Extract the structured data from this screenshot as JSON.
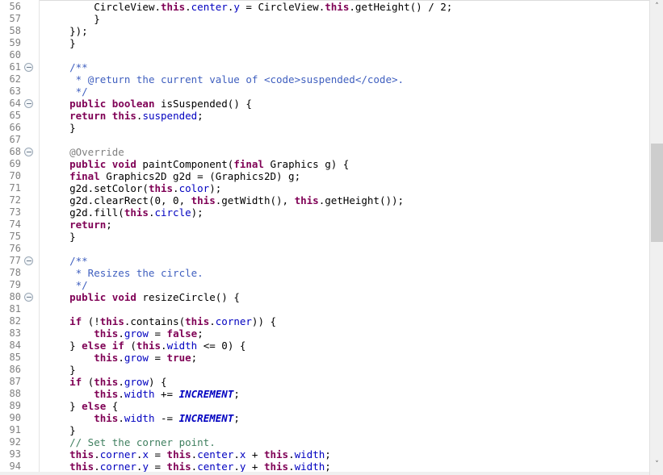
{
  "editor": {
    "first_line": 56,
    "last_line": 94,
    "line_height": 15,
    "colors": {
      "background": "#ffffff",
      "keyword": "#7f0055",
      "field": "#0000c0",
      "static_field": "#0000c0",
      "line_comment": "#3f7f5f",
      "javadoc": "#3f5fbf",
      "annotation": "#808080",
      "plain": "#000000",
      "line_number": "#808080",
      "gutter_separator": "#e4e4e4",
      "scrollbar_track": "#f0f0f0",
      "scrollbar_thumb": "#cdcdcd"
    }
  },
  "scrollbar": {
    "up_arrow": "˄",
    "down_arrow": "˅"
  },
  "lines": [
    {
      "n": 56,
      "fold": false,
      "tokens": [
        {
          "t": "        ",
          "c": "pln"
        },
        {
          "t": "CircleView",
          "c": "pln"
        },
        {
          "t": ".",
          "c": "pln"
        },
        {
          "t": "this",
          "c": "kw"
        },
        {
          "t": ".",
          "c": "pln"
        },
        {
          "t": "center",
          "c": "fld"
        },
        {
          "t": ".",
          "c": "pln"
        },
        {
          "t": "y",
          "c": "fld"
        },
        {
          "t": " = ",
          "c": "pln"
        },
        {
          "t": "CircleView",
          "c": "pln"
        },
        {
          "t": ".",
          "c": "pln"
        },
        {
          "t": "this",
          "c": "kw"
        },
        {
          "t": ".",
          "c": "pln"
        },
        {
          "t": "getHeight() / 2;",
          "c": "pln"
        }
      ]
    },
    {
      "n": 57,
      "fold": false,
      "tokens": [
        {
          "t": "        }",
          "c": "pln"
        }
      ]
    },
    {
      "n": 58,
      "fold": false,
      "tokens": [
        {
          "t": "    });",
          "c": "pln"
        }
      ]
    },
    {
      "n": 59,
      "fold": false,
      "tokens": [
        {
          "t": "    }",
          "c": "pln"
        }
      ]
    },
    {
      "n": 60,
      "fold": false,
      "tokens": [
        {
          "t": "",
          "c": "pln"
        }
      ]
    },
    {
      "n": 61,
      "fold": true,
      "tokens": [
        {
          "t": "    /**",
          "c": "doc"
        }
      ]
    },
    {
      "n": 62,
      "fold": false,
      "tokens": [
        {
          "t": "     * ",
          "c": "doc"
        },
        {
          "t": "@return",
          "c": "doc"
        },
        {
          "t": " the current value of <code>suspended</code>.",
          "c": "doc"
        }
      ]
    },
    {
      "n": 63,
      "fold": false,
      "tokens": [
        {
          "t": "     */",
          "c": "doc"
        }
      ]
    },
    {
      "n": 64,
      "fold": true,
      "tokens": [
        {
          "t": "    ",
          "c": "pln"
        },
        {
          "t": "public",
          "c": "kw"
        },
        {
          "t": " ",
          "c": "pln"
        },
        {
          "t": "boolean",
          "c": "kw"
        },
        {
          "t": " isSuspended() {",
          "c": "pln"
        }
      ]
    },
    {
      "n": 65,
      "fold": false,
      "tokens": [
        {
          "t": "    ",
          "c": "pln"
        },
        {
          "t": "return",
          "c": "kw"
        },
        {
          "t": " ",
          "c": "pln"
        },
        {
          "t": "this",
          "c": "kw"
        },
        {
          "t": ".",
          "c": "pln"
        },
        {
          "t": "suspended",
          "c": "fld"
        },
        {
          "t": ";",
          "c": "pln"
        }
      ]
    },
    {
      "n": 66,
      "fold": false,
      "tokens": [
        {
          "t": "    }",
          "c": "pln"
        }
      ]
    },
    {
      "n": 67,
      "fold": false,
      "tokens": [
        {
          "t": "",
          "c": "pln"
        }
      ]
    },
    {
      "n": 68,
      "fold": true,
      "tokens": [
        {
          "t": "    @Override",
          "c": "ann"
        }
      ]
    },
    {
      "n": 69,
      "fold": false,
      "tokens": [
        {
          "t": "    ",
          "c": "pln"
        },
        {
          "t": "public",
          "c": "kw"
        },
        {
          "t": " ",
          "c": "pln"
        },
        {
          "t": "void",
          "c": "kw"
        },
        {
          "t": " paintComponent(",
          "c": "pln"
        },
        {
          "t": "final",
          "c": "kw"
        },
        {
          "t": " Graphics g) {",
          "c": "pln"
        }
      ]
    },
    {
      "n": 70,
      "fold": false,
      "tokens": [
        {
          "t": "    ",
          "c": "pln"
        },
        {
          "t": "final",
          "c": "kw"
        },
        {
          "t": " Graphics2D g2d = (Graphics2D) g;",
          "c": "pln"
        }
      ]
    },
    {
      "n": 71,
      "fold": false,
      "tokens": [
        {
          "t": "    g2d.setColor(",
          "c": "pln"
        },
        {
          "t": "this",
          "c": "kw"
        },
        {
          "t": ".",
          "c": "pln"
        },
        {
          "t": "color",
          "c": "fld"
        },
        {
          "t": ");",
          "c": "pln"
        }
      ]
    },
    {
      "n": 72,
      "fold": false,
      "tokens": [
        {
          "t": "    g2d.clearRect(0, 0, ",
          "c": "pln"
        },
        {
          "t": "this",
          "c": "kw"
        },
        {
          "t": ".getWidth(), ",
          "c": "pln"
        },
        {
          "t": "this",
          "c": "kw"
        },
        {
          "t": ".getHeight());",
          "c": "pln"
        }
      ]
    },
    {
      "n": 73,
      "fold": false,
      "tokens": [
        {
          "t": "    g2d.fill(",
          "c": "pln"
        },
        {
          "t": "this",
          "c": "kw"
        },
        {
          "t": ".",
          "c": "pln"
        },
        {
          "t": "circle",
          "c": "fld"
        },
        {
          "t": ");",
          "c": "pln"
        }
      ]
    },
    {
      "n": 74,
      "fold": false,
      "tokens": [
        {
          "t": "    ",
          "c": "pln"
        },
        {
          "t": "return",
          "c": "kw"
        },
        {
          "t": ";",
          "c": "pln"
        }
      ]
    },
    {
      "n": 75,
      "fold": false,
      "tokens": [
        {
          "t": "    }",
          "c": "pln"
        }
      ]
    },
    {
      "n": 76,
      "fold": false,
      "tokens": [
        {
          "t": "",
          "c": "pln"
        }
      ]
    },
    {
      "n": 77,
      "fold": true,
      "tokens": [
        {
          "t": "    /**",
          "c": "doc"
        }
      ]
    },
    {
      "n": 78,
      "fold": false,
      "tokens": [
        {
          "t": "     * Resizes the circle.",
          "c": "doc"
        }
      ]
    },
    {
      "n": 79,
      "fold": false,
      "tokens": [
        {
          "t": "     */",
          "c": "doc"
        }
      ]
    },
    {
      "n": 80,
      "fold": true,
      "tokens": [
        {
          "t": "    ",
          "c": "pln"
        },
        {
          "t": "public",
          "c": "kw"
        },
        {
          "t": " ",
          "c": "pln"
        },
        {
          "t": "void",
          "c": "kw"
        },
        {
          "t": " resizeCircle() {",
          "c": "pln"
        }
      ]
    },
    {
      "n": 81,
      "fold": false,
      "tokens": [
        {
          "t": "",
          "c": "pln"
        }
      ]
    },
    {
      "n": 82,
      "fold": false,
      "tokens": [
        {
          "t": "    ",
          "c": "pln"
        },
        {
          "t": "if",
          "c": "kw"
        },
        {
          "t": " (!",
          "c": "pln"
        },
        {
          "t": "this",
          "c": "kw"
        },
        {
          "t": ".contains(",
          "c": "pln"
        },
        {
          "t": "this",
          "c": "kw"
        },
        {
          "t": ".",
          "c": "pln"
        },
        {
          "t": "corner",
          "c": "fld"
        },
        {
          "t": ")) {",
          "c": "pln"
        }
      ]
    },
    {
      "n": 83,
      "fold": false,
      "tokens": [
        {
          "t": "        ",
          "c": "pln"
        },
        {
          "t": "this",
          "c": "kw"
        },
        {
          "t": ".",
          "c": "pln"
        },
        {
          "t": "grow",
          "c": "fld"
        },
        {
          "t": " = ",
          "c": "pln"
        },
        {
          "t": "false",
          "c": "kw"
        },
        {
          "t": ";",
          "c": "pln"
        }
      ]
    },
    {
      "n": 84,
      "fold": false,
      "tokens": [
        {
          "t": "    } ",
          "c": "pln"
        },
        {
          "t": "else",
          "c": "kw"
        },
        {
          "t": " ",
          "c": "pln"
        },
        {
          "t": "if",
          "c": "kw"
        },
        {
          "t": " (",
          "c": "pln"
        },
        {
          "t": "this",
          "c": "kw"
        },
        {
          "t": ".",
          "c": "pln"
        },
        {
          "t": "width",
          "c": "fld"
        },
        {
          "t": " <= 0) {",
          "c": "pln"
        }
      ]
    },
    {
      "n": 85,
      "fold": false,
      "tokens": [
        {
          "t": "        ",
          "c": "pln"
        },
        {
          "t": "this",
          "c": "kw"
        },
        {
          "t": ".",
          "c": "pln"
        },
        {
          "t": "grow",
          "c": "fld"
        },
        {
          "t": " = ",
          "c": "pln"
        },
        {
          "t": "true",
          "c": "kw"
        },
        {
          "t": ";",
          "c": "pln"
        }
      ]
    },
    {
      "n": 86,
      "fold": false,
      "tokens": [
        {
          "t": "    }",
          "c": "pln"
        }
      ]
    },
    {
      "n": 87,
      "fold": false,
      "tokens": [
        {
          "t": "    ",
          "c": "pln"
        },
        {
          "t": "if",
          "c": "kw"
        },
        {
          "t": " (",
          "c": "pln"
        },
        {
          "t": "this",
          "c": "kw"
        },
        {
          "t": ".",
          "c": "pln"
        },
        {
          "t": "grow",
          "c": "fld"
        },
        {
          "t": ") {",
          "c": "pln"
        }
      ]
    },
    {
      "n": 88,
      "fold": false,
      "tokens": [
        {
          "t": "        ",
          "c": "pln"
        },
        {
          "t": "this",
          "c": "kw"
        },
        {
          "t": ".",
          "c": "pln"
        },
        {
          "t": "width",
          "c": "fld"
        },
        {
          "t": " += ",
          "c": "pln"
        },
        {
          "t": "INCREMENT",
          "c": "sfld"
        },
        {
          "t": ";",
          "c": "pln"
        }
      ]
    },
    {
      "n": 89,
      "fold": false,
      "tokens": [
        {
          "t": "    } ",
          "c": "pln"
        },
        {
          "t": "else",
          "c": "kw"
        },
        {
          "t": " {",
          "c": "pln"
        }
      ]
    },
    {
      "n": 90,
      "fold": false,
      "tokens": [
        {
          "t": "        ",
          "c": "pln"
        },
        {
          "t": "this",
          "c": "kw"
        },
        {
          "t": ".",
          "c": "pln"
        },
        {
          "t": "width",
          "c": "fld"
        },
        {
          "t": " -= ",
          "c": "pln"
        },
        {
          "t": "INCREMENT",
          "c": "sfld"
        },
        {
          "t": ";",
          "c": "pln"
        }
      ]
    },
    {
      "n": 91,
      "fold": false,
      "tokens": [
        {
          "t": "    }",
          "c": "pln"
        }
      ]
    },
    {
      "n": 92,
      "fold": false,
      "tokens": [
        {
          "t": "    // Set the corner point.",
          "c": "cmt"
        }
      ]
    },
    {
      "n": 93,
      "fold": false,
      "tokens": [
        {
          "t": "    ",
          "c": "pln"
        },
        {
          "t": "this",
          "c": "kw"
        },
        {
          "t": ".",
          "c": "pln"
        },
        {
          "t": "corner",
          "c": "fld"
        },
        {
          "t": ".",
          "c": "pln"
        },
        {
          "t": "x",
          "c": "fld"
        },
        {
          "t": " = ",
          "c": "pln"
        },
        {
          "t": "this",
          "c": "kw"
        },
        {
          "t": ".",
          "c": "pln"
        },
        {
          "t": "center",
          "c": "fld"
        },
        {
          "t": ".",
          "c": "pln"
        },
        {
          "t": "x",
          "c": "fld"
        },
        {
          "t": " + ",
          "c": "pln"
        },
        {
          "t": "this",
          "c": "kw"
        },
        {
          "t": ".",
          "c": "pln"
        },
        {
          "t": "width",
          "c": "fld"
        },
        {
          "t": ";",
          "c": "pln"
        }
      ]
    },
    {
      "n": 94,
      "fold": false,
      "tokens": [
        {
          "t": "    ",
          "c": "pln"
        },
        {
          "t": "this",
          "c": "kw"
        },
        {
          "t": ".",
          "c": "pln"
        },
        {
          "t": "corner",
          "c": "fld"
        },
        {
          "t": ".",
          "c": "pln"
        },
        {
          "t": "y",
          "c": "fld"
        },
        {
          "t": " = ",
          "c": "pln"
        },
        {
          "t": "this",
          "c": "kw"
        },
        {
          "t": ".",
          "c": "pln"
        },
        {
          "t": "center",
          "c": "fld"
        },
        {
          "t": ".",
          "c": "pln"
        },
        {
          "t": "y",
          "c": "fld"
        },
        {
          "t": " + ",
          "c": "pln"
        },
        {
          "t": "this",
          "c": "kw"
        },
        {
          "t": ".",
          "c": "pln"
        },
        {
          "t": "width",
          "c": "fld"
        },
        {
          "t": ";",
          "c": "pln"
        }
      ]
    }
  ]
}
